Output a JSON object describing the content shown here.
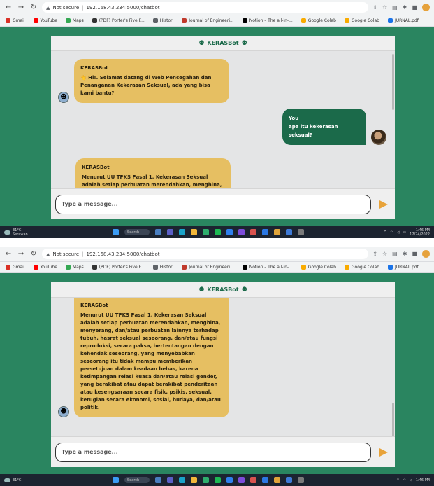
{
  "browser": {
    "security_label": "Not secure",
    "url": "192.168.43.234:5000/chatbot",
    "bookmarks": [
      {
        "label": "Gmail",
        "color": "#d93025"
      },
      {
        "label": "YouTube",
        "color": "#ff0000"
      },
      {
        "label": "Maps",
        "color": "#34a853"
      },
      {
        "label": "(PDF) Porter's Five F...",
        "color": "#333333"
      },
      {
        "label": "Histori",
        "color": "#5f6368"
      },
      {
        "label": "Journal of Engineeri...",
        "color": "#c0392b"
      },
      {
        "label": "Notion – The all-in-...",
        "color": "#000000"
      },
      {
        "label": "Google Colab",
        "color": "#f9ab00"
      },
      {
        "label": "Google Colab",
        "color": "#f9ab00"
      },
      {
        "label": "JURNAL.pdf",
        "color": "#1a73e8"
      }
    ]
  },
  "chat": {
    "title": "KERASBot",
    "bot_name": "KERASBot",
    "user_name": "You",
    "greeting": "👋 Hi!. Selamat datang di Web Pencegahan dan Penanganan Kekerasan Seksual, ada yang bisa kami bantu?",
    "user_question": "apa itu kekerasan seksual?",
    "bot_answer": "Menurut UU TPKS Pasal 1, Kekerasan Seksual adalah setiap perbuatan merendahkan, menghina, menyerang, dan/atau perbuatan lainnya terhadap tubuh, hasrat seksual seseorang, dan/atau fungsi reproduksi, secara paksa, bertentangan dengan kehendak seseorang, yang menyebabkan seseorang itu tidak mampu memberikan persetujuan dalam keadaan bebas, karena ketimpangan relasi kuasa dan/atau relasi gender, yang berakibat atau dapat berakibat penderitaan atau kesengsaraan secara fisik, psikis, seksual, kerugian secara ekonomi, sosial, budaya, dan/atau politik.",
    "bot_answer_partial": "Menurut UU TPKS Pasal 1, Kekerasan Seksual adalah setiap perbuatan merendahkan, menghina, menyerang, dan/atau perbuatan lainnya terhadap",
    "input_placeholder": "Type a message..."
  },
  "taskbar": {
    "temperature": "31°C",
    "location": "Serawan",
    "search_label": "Search",
    "time": "1:46 PM",
    "date": "12/24/2022"
  },
  "colors": {
    "page_bg": "#2a8560",
    "bot_bubble": "#e6bf62",
    "user_bubble": "#1b6a4a",
    "send_button": "#e8a33a"
  }
}
